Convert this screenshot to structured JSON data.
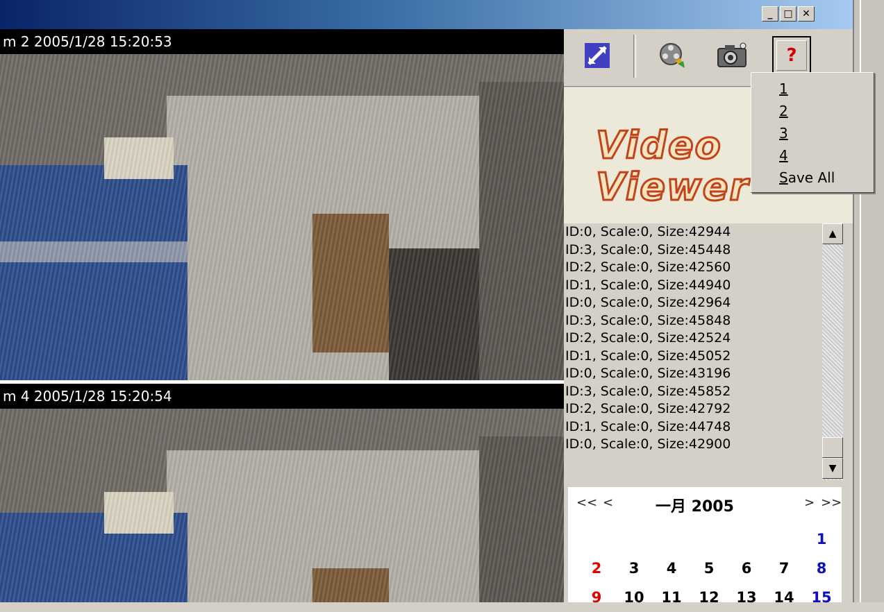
{
  "window": {
    "min_label": "_",
    "max_label": "□",
    "close_label": "✕"
  },
  "cameras": [
    {
      "title": "m 2 2005/1/28 15:20:53"
    },
    {
      "title": "m 4 2005/1/28 15:20:54"
    }
  ],
  "toolbar": {
    "help_label": "?"
  },
  "logo": {
    "line1": "Video",
    "line2": "Viewer"
  },
  "log": {
    "rows": [
      "ID:0, Scale:0, Size:42944",
      "ID:3, Scale:0, Size:45448",
      "ID:2, Scale:0, Size:42560",
      "ID:1, Scale:0, Size:44940",
      "ID:0, Scale:0, Size:42964",
      "ID:3, Scale:0, Size:45848",
      "ID:2, Scale:0, Size:42524",
      "ID:1, Scale:0, Size:45052",
      "ID:0, Scale:0, Size:43196",
      "ID:3, Scale:0, Size:45852",
      "ID:2, Scale:0, Size:42792",
      "ID:1, Scale:0, Size:44748",
      "ID:0, Scale:0, Size:42900"
    ]
  },
  "calendar": {
    "prev_year": "<<",
    "prev_month": "<",
    "month_label": "一月 2005",
    "next_month": ">",
    "next_year": ">>",
    "weeks": [
      [
        "",
        "",
        "",
        "",
        "",
        "",
        "1"
      ],
      [
        "2",
        "3",
        "4",
        "5",
        "6",
        "7",
        "8"
      ],
      [
        "9",
        "10",
        "11",
        "12",
        "13",
        "14",
        "15"
      ]
    ],
    "sunday_color": "#e00000",
    "saturday_color": "#1010c0"
  },
  "snapshot_menu": {
    "items": [
      {
        "mnemonic": "1",
        "rest": ""
      },
      {
        "mnemonic": "2",
        "rest": ""
      },
      {
        "mnemonic": "3",
        "rest": ""
      },
      {
        "mnemonic": "4",
        "rest": ""
      },
      {
        "mnemonic": "S",
        "rest": "ave All"
      }
    ]
  }
}
